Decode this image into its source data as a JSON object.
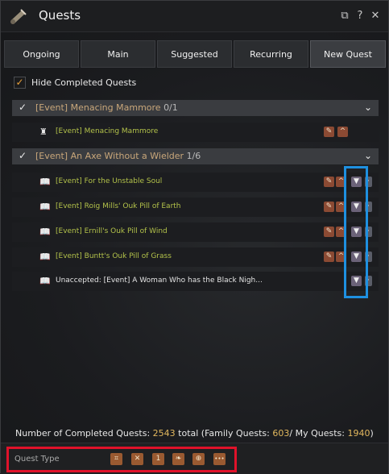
{
  "window": {
    "title": "Quests",
    "title_icon": "scroll-quill-icon"
  },
  "titlebar_buttons": {
    "popout": "⧉",
    "help": "?",
    "close": "✕"
  },
  "tabs": [
    {
      "label": "Ongoing"
    },
    {
      "label": "Main"
    },
    {
      "label": "Suggested"
    },
    {
      "label": "Recurring"
    },
    {
      "label": "New Quest",
      "active": true
    }
  ],
  "hide_completed": {
    "label": "Hide Completed Quests",
    "checked": true
  },
  "groups": [
    {
      "title": "[Event] Menacing Mammore",
      "count": "0/1",
      "quests": [
        {
          "name": "[Event] Menacing Mammore",
          "icon": "tower-icon"
        }
      ]
    },
    {
      "title": "[Event] An Axe Without a Wielder",
      "count": "1/6",
      "quests": [
        {
          "name": "[Event] For the Unstable Soul",
          "icon": "book-icon"
        },
        {
          "name": "[Event] Roig Mills' Ouk Pill of Earth",
          "icon": "book-icon"
        },
        {
          "name": "[Event] Ernill's Ouk Pill of Wind",
          "icon": "book-icon"
        },
        {
          "name": "[Event] Buntt's Ouk Pill of Grass",
          "icon": "book-icon"
        },
        {
          "name": "Unaccepted: [Event] A Woman Who has the Black Nigh...",
          "icon": "book-icon"
        }
      ]
    }
  ],
  "summary": {
    "prefix": "Number of Completed Quests:",
    "total": "2543",
    "total_suffix": "total (Family Quests:",
    "family": "603",
    "sep": "/ My Quests:",
    "mine": "1940",
    "close": ")"
  },
  "footer": {
    "label": "Quest Type",
    "buttons": [
      {
        "icon": "target-frame-icon",
        "glyph": "⌗"
      },
      {
        "icon": "crossed-swords-icon",
        "glyph": "✕"
      },
      {
        "icon": "number-one-icon",
        "glyph": "1"
      },
      {
        "icon": "leaf-icon",
        "glyph": "❧"
      },
      {
        "icon": "compass-icon",
        "glyph": "⊕"
      },
      {
        "icon": "more-icon",
        "glyph": "•••"
      }
    ]
  },
  "colors": {
    "highlight_blue": "#1e90e0",
    "highlight_red": "#e0122a",
    "accent_orange": "#e9a13b"
  }
}
